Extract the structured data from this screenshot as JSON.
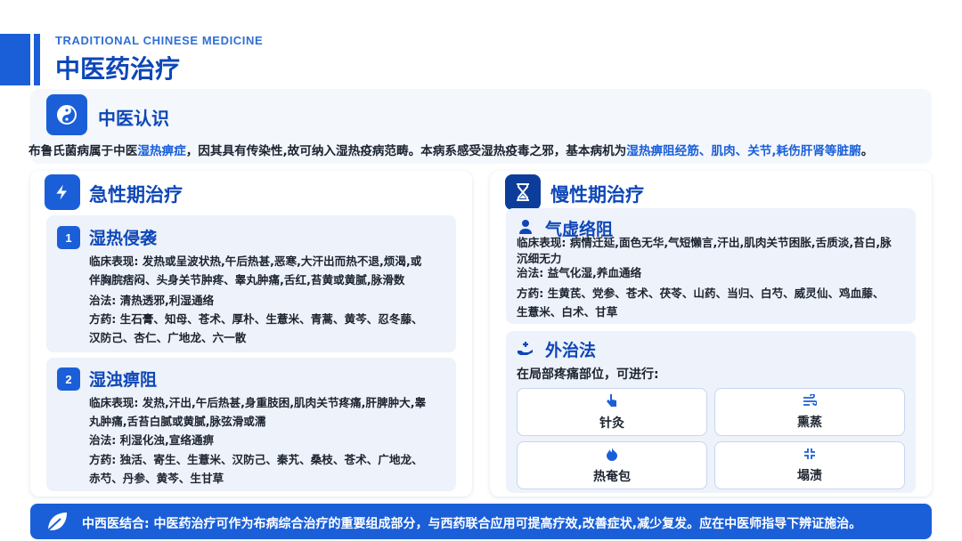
{
  "header": {
    "subtitle": "TRADITIONAL CHINESE MEDICINE",
    "title": "中医药治疗"
  },
  "intro": {
    "title": "中医认识",
    "icon": "yin-yang-icon",
    "text_parts": [
      {
        "t": "布鲁氏菌病属于中医",
        "hl": false
      },
      {
        "t": "湿热痹症",
        "hl": true
      },
      {
        "t": "，因其具有传染性,故可纳入湿热疫病范畴。本病系感受湿热疫毒之邪，基本病机为",
        "hl": false
      },
      {
        "t": "湿热痹阻经筋、肌肉、关节,耗伤肝肾等脏腑",
        "hl": true
      },
      {
        "t": "。",
        "hl": false
      }
    ]
  },
  "acute": {
    "title": "急性期治疗",
    "icon": "lightning-icon",
    "items": [
      {
        "num": "1",
        "title": "湿热侵袭",
        "symptoms_label": "临床表现: ",
        "symptoms_line1": "发热或呈波状热,午后热甚,恶寒,大汗出而热不退,烦渴,或",
        "symptoms_line2": "伴胸脘痞闷、头身关节肿疼、睾丸肿痛,舌红,苔黄或黄腻,脉滑数",
        "method_label": "治法: ",
        "method": "清热透邪,利湿通络",
        "rx_label": "方药: ",
        "rx_line1": "生石膏、知母、苍术、厚朴、生薏米、青蒿、黄芩、忍冬藤、",
        "rx_line2": "汉防己、杏仁、广地龙、六一散"
      },
      {
        "num": "2",
        "title": "湿浊痹阻",
        "symptoms_label": "临床表现: ",
        "symptoms_line1": "发热,汗出,午后热甚,身重肢困,肌肉关节疼痛,肝脾肿大,睾",
        "symptoms_line2": "丸肿痛,舌苔白腻或黄腻,脉弦滑或濡",
        "method_label": "治法: ",
        "method": "利湿化浊,宣络通痹",
        "rx_label": "方药: ",
        "rx_line1": "独活、寄生、生薏米、汉防己、秦艽、桑枝、苍术、广地龙、",
        "rx_line2": "赤芍、丹参、黄芩、生甘草"
      }
    ]
  },
  "chronic": {
    "title": "慢性期治疗",
    "icon": "hourglass-icon",
    "qixu": {
      "title": "气虚络阻",
      "icon": "person-icon",
      "symptoms_label": "临床表现: ",
      "symptoms_line1": "病情迁延,面色无华,气短懒言,汗出,肌肉关节困胀,舌质淡,苔白,脉",
      "symptoms_line2": "沉细无力",
      "method_label": "治法: ",
      "method": "益气化湿,养血通络",
      "rx_label": "方药: ",
      "rx_line1": "生黄芪、党参、苍术、茯苓、山药、当归、白芍、威灵仙、鸡血藤、",
      "rx_line2": "生薏米、白术、甘草"
    },
    "external": {
      "title": "外治法",
      "icon": "hand-heart-icon",
      "intro": "在局部疼痛部位，可进行:",
      "methods": [
        {
          "label": "针灸",
          "icon": "hand-pointer-icon"
        },
        {
          "label": "熏蒸",
          "icon": "wind-icon"
        },
        {
          "label": "热奄包",
          "icon": "fire-icon"
        },
        {
          "label": "塌渍",
          "icon": "compress-icon"
        }
      ]
    }
  },
  "footer": {
    "icon": "leaf-icon",
    "text": "中西医结合: 中医药治疗可作为布病综合治疗的重要组成部分，与西药联合应用可提高疗效,改善症状,减少复发。应在中医师指导下辨证施治。"
  },
  "colors": {
    "primary": "#1a5fd8",
    "title": "#0d47b8",
    "panel": "#f4f7fc"
  }
}
